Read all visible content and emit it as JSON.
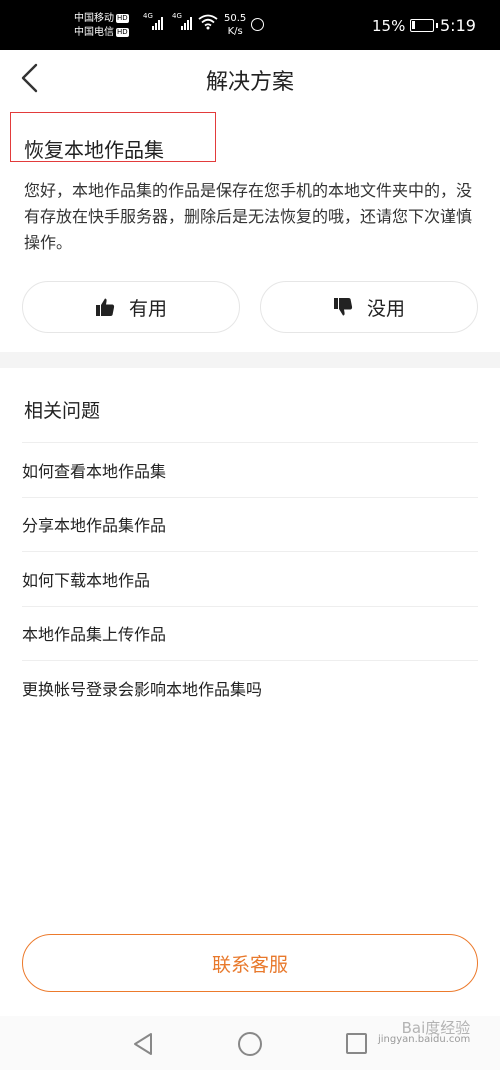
{
  "status_bar": {
    "carrier1": "中国移动",
    "carrier2": "中国电信",
    "hd_badge": "HD",
    "network1": "4G",
    "network2": "4G",
    "speed_value": "50.5",
    "speed_unit": "K/s",
    "battery_percent": "15%",
    "battery_level": 0.15,
    "time": "5:19"
  },
  "header": {
    "title": "解决方案",
    "back_icon": "chevron-left-icon"
  },
  "solution": {
    "title": "恢复本地作品集",
    "body": "您好，本地作品集的作品是保存在您手机的本地文件夹中的，没有存放在快手服务器，删除后是无法恢复的哦，还请您下次谨慎操作。",
    "highlight_color": "#e23b3b"
  },
  "feedback": {
    "useful_label": "有用",
    "useful_icon": "thumbs-up-icon",
    "useless_label": "没用",
    "useless_icon": "thumbs-down-icon"
  },
  "related": {
    "title": "相关问题",
    "items": [
      "如何查看本地作品集",
      "分享本地作品集作品",
      "如何下载本地作品",
      "本地作品集上传作品",
      "更换帐号登录会影响本地作品集吗"
    ]
  },
  "contact": {
    "label": "联系客服",
    "accent_color": "#ec7a2c"
  },
  "watermark": {
    "line1": "Bai度经验",
    "line2": "jingyan.baidu.com"
  }
}
